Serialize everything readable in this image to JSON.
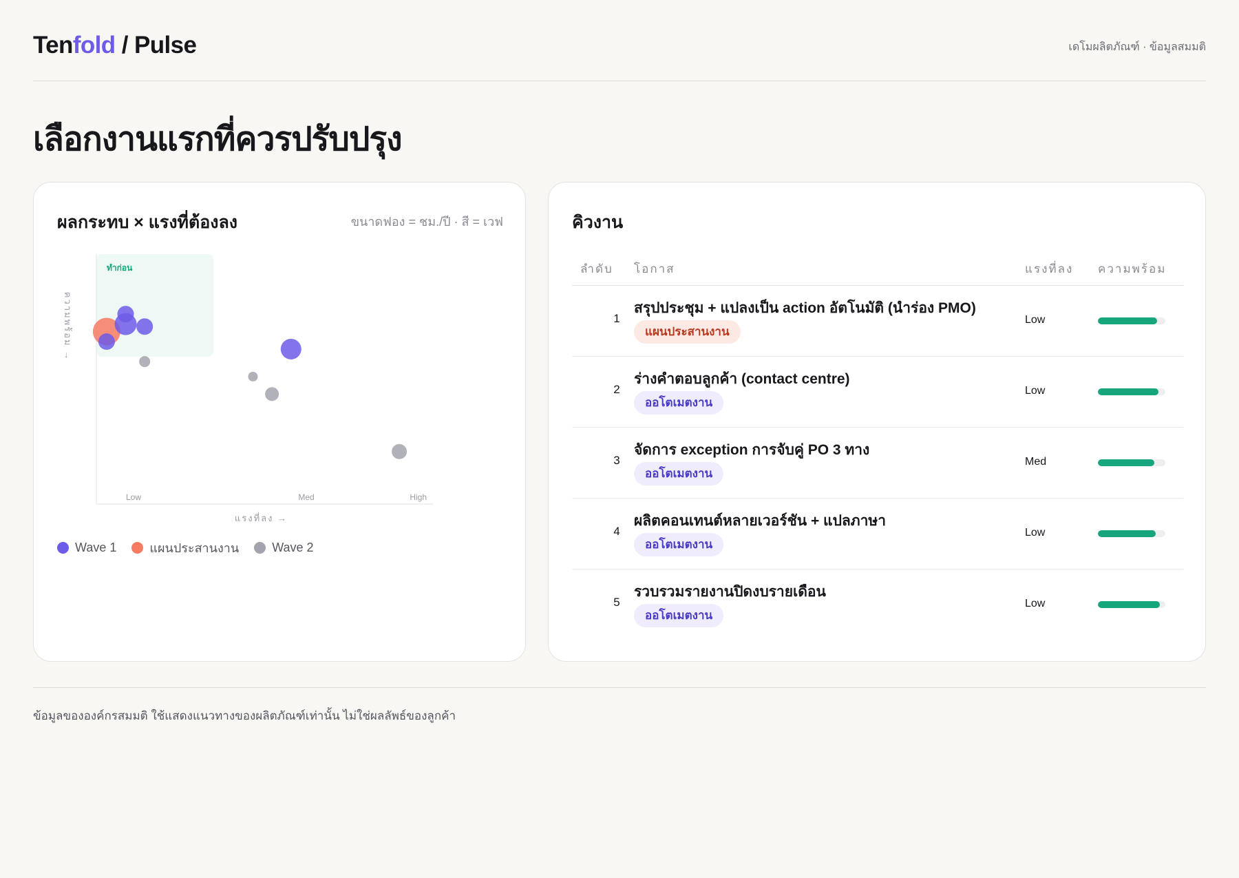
{
  "header": {
    "logo_ten": "Ten",
    "logo_fold": "fold",
    "logo_rest": " / Pulse",
    "meta": "เดโมผลิตภัณฑ์ · ข้อมูลสมมติ"
  },
  "page": {
    "title": "เลือกงานแรกที่ควรปรับปรุง"
  },
  "chart_panel": {
    "title": "ผลกระทบ × แรงที่ต้องลง",
    "note": "ขนาดฟอง = ชม./ปี · สี = เวฟ",
    "legend": [
      {
        "label": "Wave 1",
        "color": "#6d5ce7"
      },
      {
        "label": "แผนประสานงาน",
        "color": "#f77a63"
      },
      {
        "label": "Wave 2",
        "color": "#a3a3ad"
      }
    ]
  },
  "chart_data": {
    "type": "scatter",
    "xlabel": "แรงที่ลง →",
    "ylabel": "ความพร้อม →",
    "x_ticks": [
      "Low",
      "Med",
      "High"
    ],
    "xlim": [
      0,
      2.3
    ],
    "ylim": [
      0,
      100
    ],
    "quadrant_label": "ทำก่อน",
    "quadrant": {
      "x": [
        0,
        0.8
      ],
      "y": [
        59,
        100
      ]
    },
    "colors": {
      "Wave 1": "#6d5ce7",
      "แผนประสานงาน": "#f77a63",
      "Wave 2": "#a3a3ad"
    },
    "points": [
      {
        "series": "แผนประสานงาน",
        "x": 0.07,
        "y": 69,
        "size": 20
      },
      {
        "series": "Wave 1",
        "x": 0.07,
        "y": 65,
        "size": 12
      },
      {
        "series": "Wave 1",
        "x": 0.2,
        "y": 72,
        "size": 16
      },
      {
        "series": "Wave 1",
        "x": 0.2,
        "y": 76,
        "size": 12
      },
      {
        "series": "Wave 1",
        "x": 0.33,
        "y": 71,
        "size": 12
      },
      {
        "series": "Wave 1",
        "x": 1.33,
        "y": 62,
        "size": 15
      },
      {
        "series": "Wave 2",
        "x": 0.33,
        "y": 57,
        "size": 8
      },
      {
        "series": "Wave 2",
        "x": 1.07,
        "y": 51,
        "size": 7
      },
      {
        "series": "Wave 2",
        "x": 1.2,
        "y": 44,
        "size": 10
      },
      {
        "series": "Wave 2",
        "x": 2.07,
        "y": 21,
        "size": 11
      }
    ]
  },
  "queue": {
    "title": "คิวงาน",
    "columns": {
      "rank": "ลำดับ",
      "opportunity": "โอกาส",
      "effort": "แรงที่ลง",
      "readiness": "ความพร้อม"
    },
    "rows": [
      {
        "rank": "1",
        "title": "สรุปประชุม + แปลงเป็น action อัตโนมัติ (นำร่อง PMO)",
        "tag": "แผนประสานงาน",
        "tag_kind": "coord",
        "effort": "Low",
        "readiness": 0.88
      },
      {
        "rank": "2",
        "title": "ร่างคำตอบลูกค้า (contact centre)",
        "tag": "ออโตเมตงาน",
        "tag_kind": "auto",
        "effort": "Low",
        "readiness": 0.9
      },
      {
        "rank": "3",
        "title": "จัดการ exception การจับคู่ PO 3 ทาง",
        "tag": "ออโตเมตงาน",
        "tag_kind": "auto",
        "effort": "Med",
        "readiness": 0.84
      },
      {
        "rank": "4",
        "title": "ผลิตคอนเทนต์หลายเวอร์ชัน + แปลภาษา",
        "tag": "ออโตเมตงาน",
        "tag_kind": "auto",
        "effort": "Low",
        "readiness": 0.86
      },
      {
        "rank": "5",
        "title": "รวบรวมรายงานปิดงบรายเดือน",
        "tag": "ออโตเมตงาน",
        "tag_kind": "auto",
        "effort": "Low",
        "readiness": 0.92
      }
    ]
  },
  "footer": {
    "note": "ข้อมูลขององค์กรสมมติ ใช้แสดงแนวทางของผลิตภัณฑ์เท่านั้น ไม่ใช่ผลลัพธ์ของลูกค้า"
  }
}
